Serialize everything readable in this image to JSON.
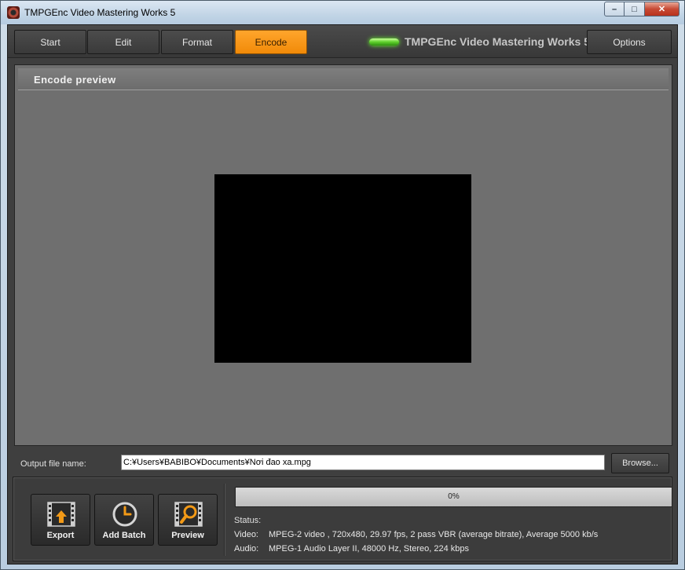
{
  "window": {
    "title": "TMPGEnc Video Mastering Works 5",
    "controls": {
      "minimize": "–",
      "maximize": "□",
      "close": "✕"
    }
  },
  "nav": {
    "tabs": [
      {
        "label": "Start",
        "active": false
      },
      {
        "label": "Edit",
        "active": false
      },
      {
        "label": "Format",
        "active": false
      },
      {
        "label": "Encode",
        "active": true
      }
    ],
    "brand": "TMPGEnc Video Mastering Works 5",
    "options_label": "Options"
  },
  "preview": {
    "title": "Encode preview"
  },
  "output": {
    "label": "Output file name:",
    "value": "C:¥Users¥BABIBO¥Documents¥Nơi đao xa.mpg",
    "browse_label": "Browse..."
  },
  "actions": [
    {
      "label": "Export",
      "icon": "export-film-icon"
    },
    {
      "label": "Add Batch",
      "icon": "clock-icon"
    },
    {
      "label": "Preview",
      "icon": "magnifier-film-icon"
    }
  ],
  "progress": {
    "percent": 0,
    "text": "0%"
  },
  "status": {
    "label": "Status:",
    "video_key": "Video:",
    "video_value": "MPEG-2 video , 720x480, 29.97 fps, 2 pass VBR (average bitrate), Average 5000 kb/s",
    "audio_key": "Audio:",
    "audio_value": "MPEG-1 Audio Layer II, 48000 Hz, Stereo, 224 kbps"
  },
  "colors": {
    "accent": "#f18a08",
    "panel": "#3f3f3f",
    "preview_bg": "#6f6f6f"
  }
}
